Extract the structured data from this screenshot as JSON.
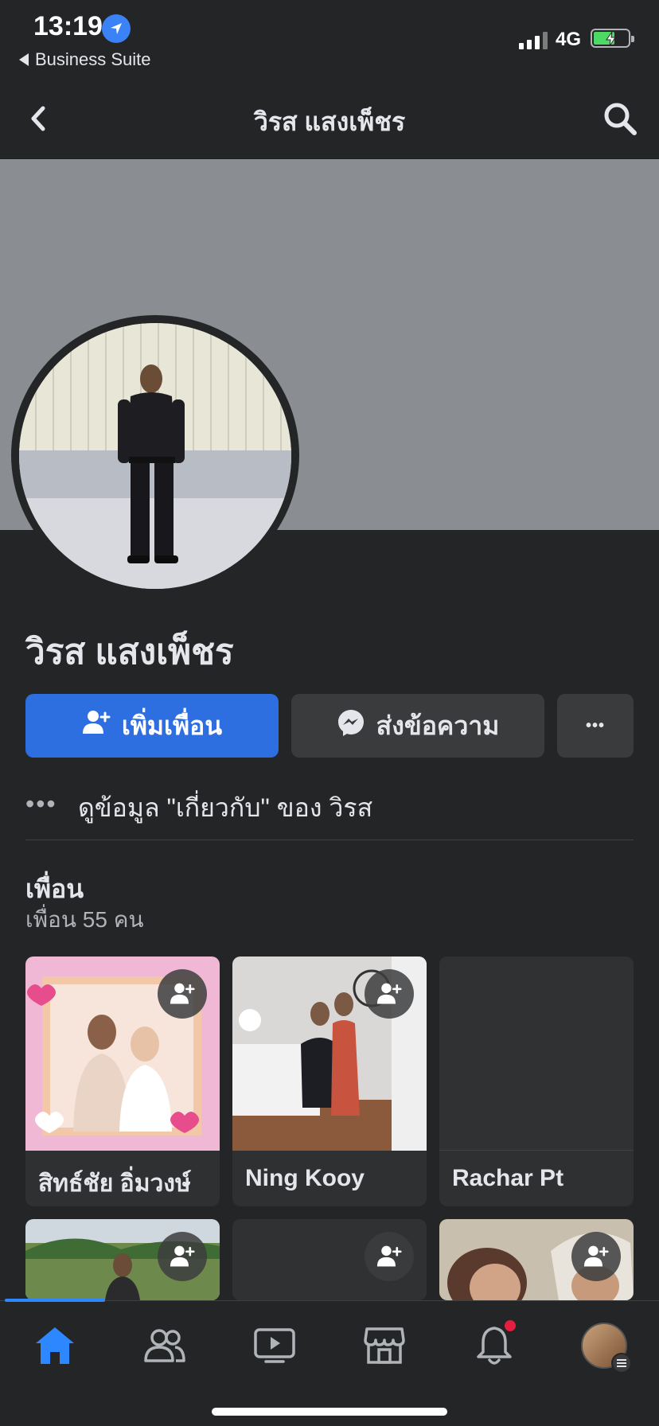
{
  "status_bar": {
    "time": "13:19",
    "back_app_label": "Business Suite",
    "network": "4G"
  },
  "navbar": {
    "title": "วิรส แสงเพ็ชร"
  },
  "profile": {
    "name": "วิรส แสงเพ็ชร",
    "add_friend_label": "เพิ่มเพื่อน",
    "message_label": "ส่งข้อความ",
    "more_label": "•••",
    "about_dots": "•••",
    "about_text": "ดูข้อมูล \"เกี่ยวกับ\" ของ วิรส"
  },
  "friends": {
    "title": "เพื่อน",
    "count_text": "เพื่อน 55 คน",
    "items": [
      {
        "name": "สิทธ์ชัย อิ่มวงษ์"
      },
      {
        "name": "Ning Kooy"
      },
      {
        "name": "Rachar Pt"
      },
      {
        "name": ""
      },
      {
        "name": ""
      },
      {
        "name": ""
      }
    ]
  },
  "colors": {
    "background": "#242526",
    "accent": "#2d6ee0",
    "secondary_button": "#3a3b3c",
    "cover": "#8a8d91",
    "notification": "#e41e3f"
  },
  "icons": {
    "tabs": [
      "home-icon",
      "friends-icon",
      "watch-icon",
      "marketplace-icon",
      "notifications-icon",
      "menu-avatar"
    ]
  }
}
